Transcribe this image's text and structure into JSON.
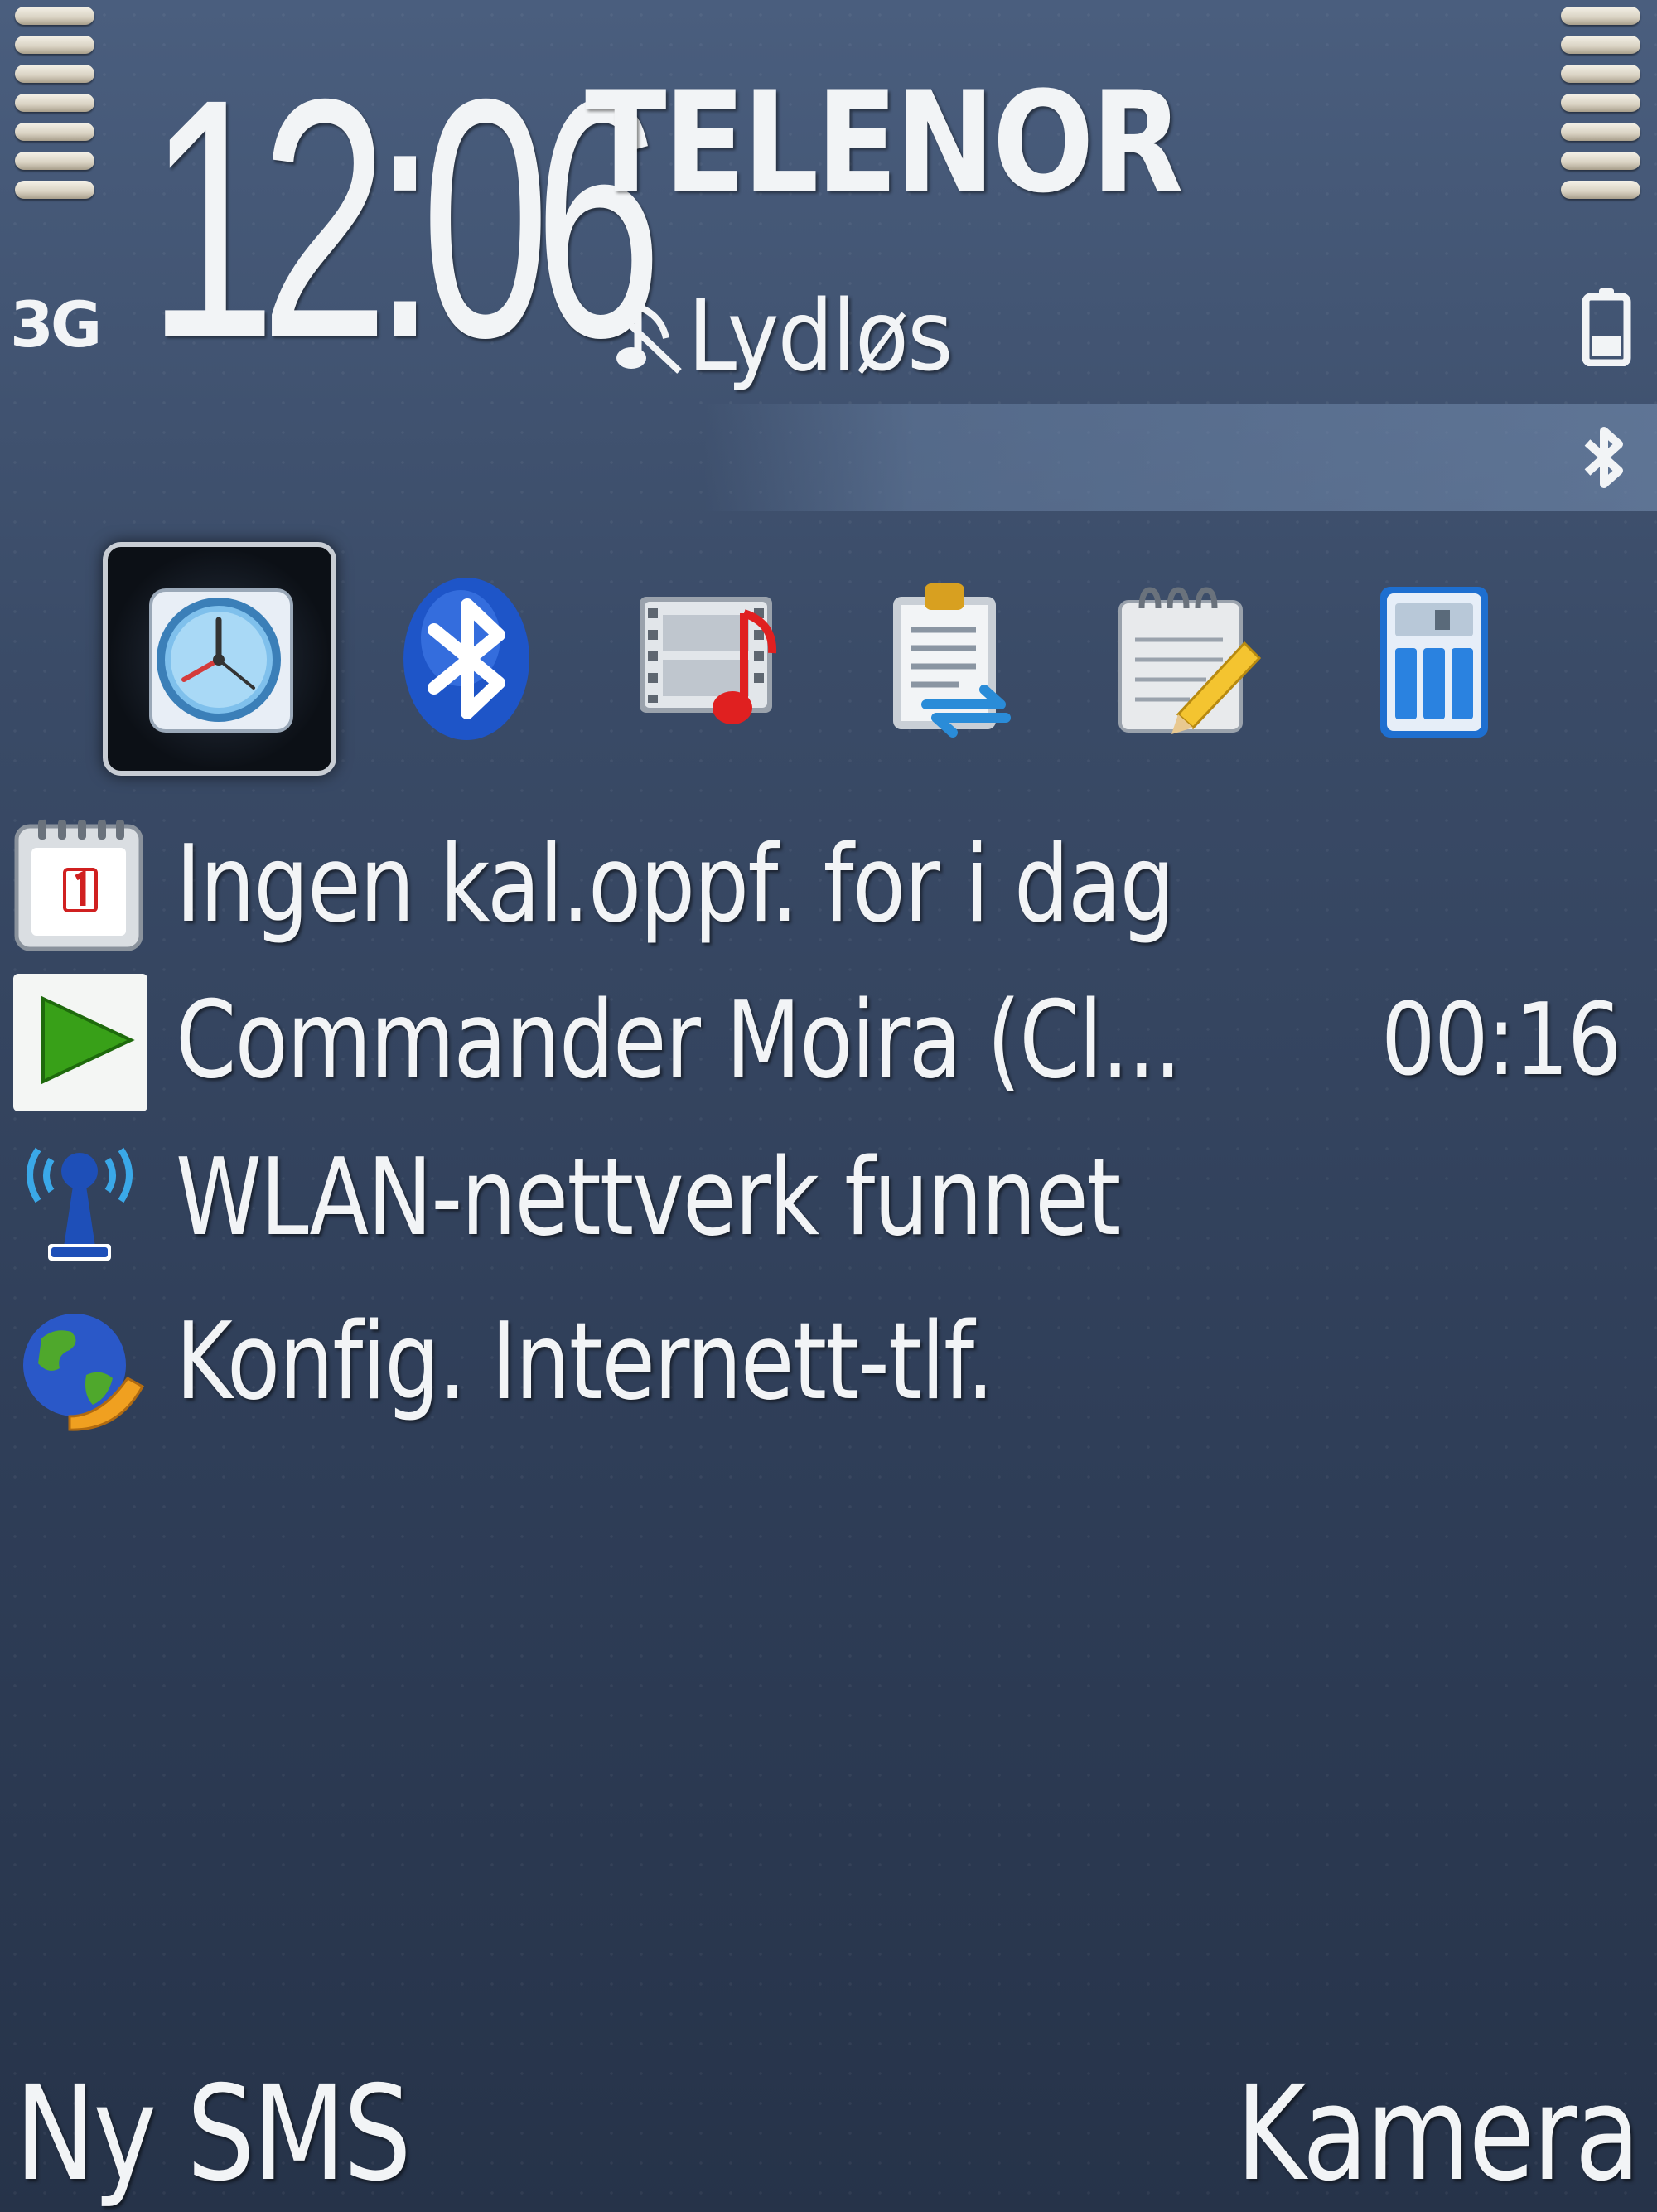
{
  "status": {
    "network_type": "3G",
    "time": "12:06",
    "operator": "TELENOR",
    "profile": "Lydløs",
    "signal_level": 1.0,
    "battery_level": 1.0
  },
  "shortcuts": [
    {
      "icon": "clock-icon",
      "selected": true
    },
    {
      "icon": "bluetooth-icon",
      "selected": false
    },
    {
      "icon": "media-player-icon",
      "selected": false
    },
    {
      "icon": "data-transfer-icon",
      "selected": false
    },
    {
      "icon": "notes-icon",
      "selected": false
    },
    {
      "icon": "calculator-icon",
      "selected": false
    }
  ],
  "info": {
    "calendar": {
      "text": "Ingen kal.oppf. for i dag",
      "icon": "calendar-icon"
    },
    "music": {
      "text": "Commander Moira (Cl...",
      "time": "00:16",
      "icon": "play-icon"
    },
    "wlan": {
      "text": "WLAN-nettverk funnet",
      "icon": "wlan-icon"
    },
    "internet_phone": {
      "text": "Konfig. Internett-tlf.",
      "icon": "globe-phone-icon"
    }
  },
  "softkeys": {
    "left": "Ny SMS",
    "right": "Kamera"
  },
  "colors": {
    "background_top": "#4a5e7e",
    "background_bottom": "#263349",
    "text": "#f2f4f6"
  }
}
